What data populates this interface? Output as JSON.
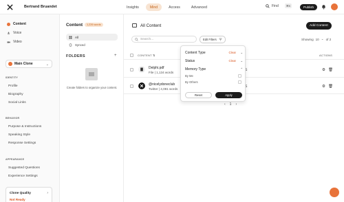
{
  "header": {
    "user_name": "Bertrand Bruandet",
    "nav": [
      "Insights",
      "Mind",
      "Access",
      "Advanced"
    ],
    "active_nav": "Mind",
    "find_label": "Find",
    "find_shortcut": "⌘K",
    "publish_label": "Publish"
  },
  "sidebar": {
    "main_items": [
      {
        "label": "Content",
        "icon": "content-icon"
      },
      {
        "label": "Voice",
        "icon": "microphone-icon"
      },
      {
        "label": "Video",
        "icon": "video-icon"
      }
    ],
    "clone_select": "Main Clone",
    "sections": [
      {
        "title": "IDENTITY",
        "links": [
          "Profile",
          "Biography",
          "Social Links"
        ]
      },
      {
        "title": "BEHAVIOR",
        "links": [
          "Purpose & Instructions",
          "Speaking Style",
          "Response Settings"
        ]
      },
      {
        "title": "APPEARANCE",
        "links": [
          "Suggested Questions",
          "Experience Settings"
        ]
      }
    ],
    "quality": {
      "title": "Clone Quality",
      "status": "Not Ready"
    }
  },
  "content_pane": {
    "title": "Content",
    "words_badge": "1,226 words",
    "filters": [
      {
        "label": "All",
        "icon": "grid-icon"
      },
      {
        "label": "Synced",
        "icon": "sync-icon"
      }
    ],
    "folders_label": "FOLDERS",
    "empty_text": "Create folders to organize your content."
  },
  "main": {
    "title": "All Content",
    "add_button": "Add Content",
    "search_placeholder": "Search...",
    "edit_filters": "Edit Filters",
    "showing_label": "Showing",
    "showing_value": "10",
    "showing_of": "of 2",
    "columns": {
      "content": "CONTENT",
      "actions": "ACTIONS"
    },
    "rows": [
      {
        "name": "Delphi.pdf",
        "meta": "File | 1,134 words",
        "icon": "file-icon",
        "peek": "S"
      },
      {
        "name": "@nicelydoneclub",
        "meta": "Twitter | 4,081 words",
        "icon": "x-icon",
        "peek": "S"
      }
    ],
    "pager": {
      "prev": "‹",
      "page": "1",
      "next": "›"
    }
  },
  "filter_popover": {
    "content_type": "Content Type",
    "status": "Status",
    "memory_type": "Memory Type",
    "clear_label": "Clear",
    "options": [
      "By Me",
      "By Others"
    ],
    "reset": "Reset",
    "apply": "Apply"
  },
  "colors": {
    "accent": "#e8733a",
    "dark": "#1c1c1c"
  }
}
